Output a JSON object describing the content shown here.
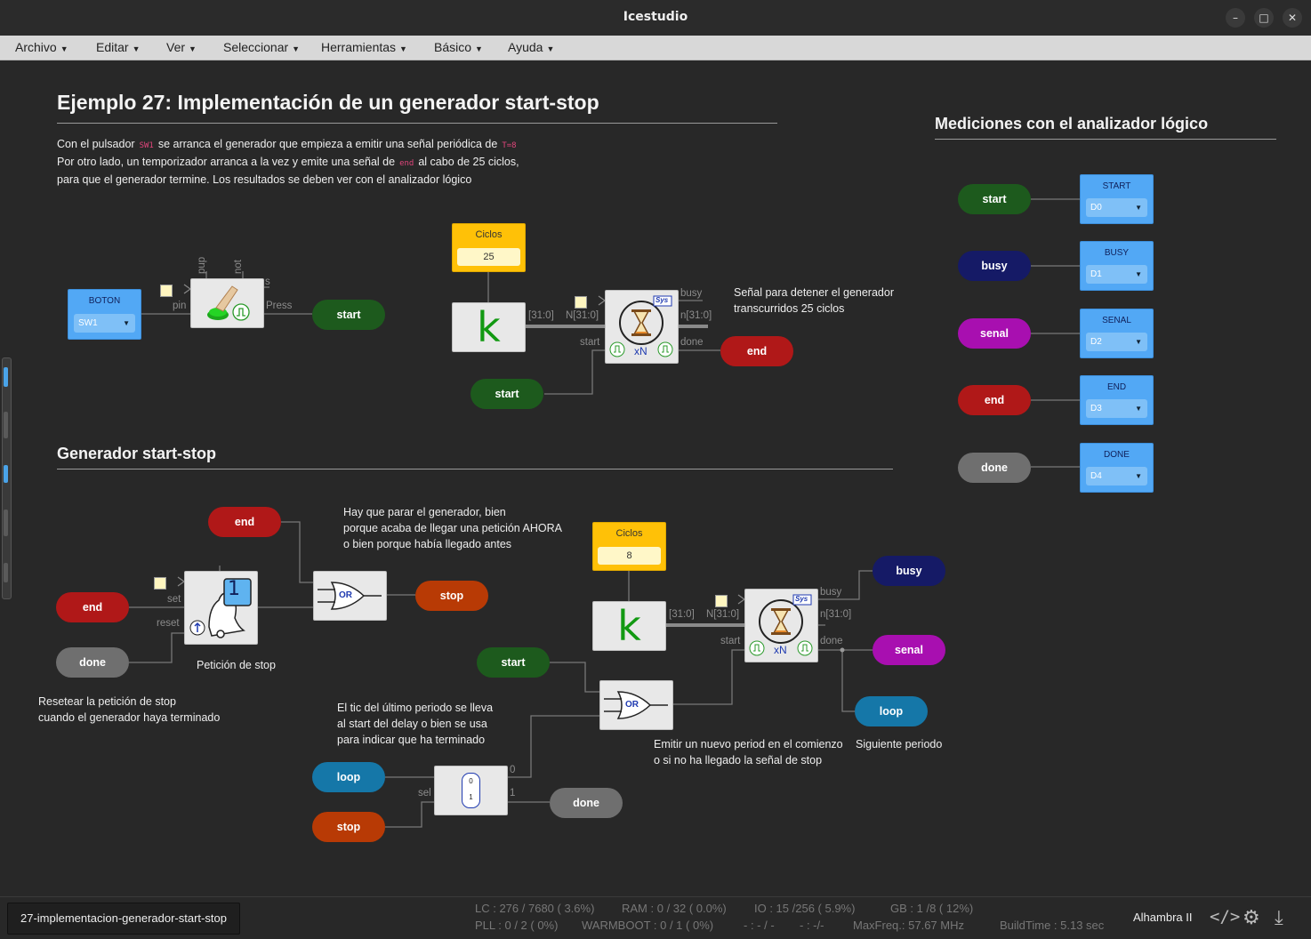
{
  "window": {
    "title": "Icestudio"
  },
  "menu": [
    "Archivo",
    "Editar",
    "Ver",
    "Seleccionar",
    "Herramientas",
    "Básico",
    "Ayuda"
  ],
  "main_title": "Ejemplo 27: Implementación de un generador start-stop",
  "intro": {
    "l1a": "Con el pulsador",
    "l1code": "SW1",
    "l1b": "se arranca el generador que empieza a emitir una señal periódica de",
    "l1code2": "T=8",
    "l2a": "Por otro lado, un temporizador arranca a la vez y emite una señal de",
    "l2code": "end",
    "l2b": "al cabo de 25 ciclos,",
    "l3": "para que el generador termine. Los resultados se deben ver con el analizador lógico"
  },
  "boton": {
    "label": "BOTON",
    "value": "SW1"
  },
  "button_block": {
    "pup": "pup",
    "not": "not",
    "s": "s",
    "pin": "pin",
    "press": "Press"
  },
  "pills": {
    "start": "start",
    "busy": "busy",
    "senal": "senal",
    "end": "end",
    "done": "done",
    "stop": "stop",
    "loop": "loop"
  },
  "ciclos1": {
    "label": "Ciclos",
    "value": "25"
  },
  "ciclos2": {
    "label": "Ciclos",
    "value": "8"
  },
  "timer_ports": {
    "bus": "[31:0]",
    "N": "N[31:0]",
    "n": "n[31:0]",
    "busy": "busy",
    "start": "start",
    "done": "done",
    "sys": "Sys",
    "xn": "xN"
  },
  "note_stop": {
    "l1": "Señal para detener el generador",
    "l2": "transcurridos 25 ciclos"
  },
  "section2": "Generador start-stop",
  "stopreq": {
    "set": "set",
    "reset": "reset",
    "num": "1",
    "caption": "Petición de stop"
  },
  "or_label": "OR",
  "note_parar": {
    "l1": "Hay que parar el generador, bien",
    "l2": "porque acaba de llegar una petición AHORA",
    "l3": "o bien porque había llegado antes"
  },
  "note_reset": {
    "l1": "Resetear la petición de stop",
    "l2": "cuando el generador haya terminado"
  },
  "note_tic": {
    "l1": "El tic del último periodo se lleva",
    "l2": "al start del delay o bien se usa",
    "l3": "para indicar que ha terminado"
  },
  "demux": {
    "p0": "0",
    "p1": "1",
    "sel": "sel",
    "i0": "0",
    "i1": "1"
  },
  "note_emit": {
    "l1": "Emitir un nuevo period en el comienzo",
    "l2": "o si no ha llegado la señal de stop"
  },
  "note_next": "Siguiente periodo",
  "analyzer": {
    "title": "Mediciones con el analizador lógico",
    "channels": [
      {
        "signal": "start",
        "label": "START",
        "pin": "D0",
        "color": "#1d5a1d"
      },
      {
        "signal": "busy",
        "label": "BUSY",
        "pin": "D1",
        "color": "#151a66"
      },
      {
        "signal": "senal",
        "label": "SENAL",
        "pin": "D2",
        "color": "#a80fb0"
      },
      {
        "signal": "end",
        "label": "END",
        "pin": "D3",
        "color": "#b01818"
      },
      {
        "signal": "done",
        "label": "DONE",
        "pin": "D4",
        "color": "#6f6f6f"
      }
    ]
  },
  "status": {
    "file": "27-implementacion-generador-start-stop",
    "lc": "LC : 276 / 7680 ( 3.6%)",
    "ram": "RAM : 0 / 32 ( 0.0%)",
    "io": "IO : 15 /256 ( 5.9%)",
    "gb": "GB : 1 /8 ( 12%)",
    "pll": "PLL : 0 / 2 ( 0%)",
    "warmboot": "WARMBOOT : 0 / 1 ( 0%)",
    "dash1": "- : - / -",
    "dash2": "- : -/-",
    "maxfreq": "MaxFreq.: 57.67 MHz",
    "buildtime": "BuildTime : 5.13 sec",
    "board": "Alhambra II"
  }
}
